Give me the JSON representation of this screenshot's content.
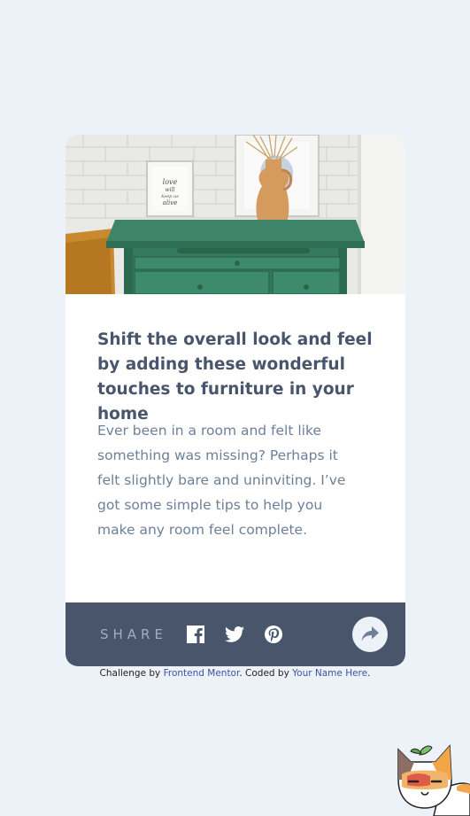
{
  "article": {
    "title": "Shift the overall look and feel by adding these wonderful touches to furniture in your home",
    "description": "Ever been in a room and felt like something was missing? Perhaps it felt slightly bare and uninviting. I’ve got some simple tips to help you make any room feel complete.",
    "hero_frame_text": "love will keep us alive"
  },
  "share_bar": {
    "label": "SHARE",
    "icons": [
      "facebook-icon",
      "twitter-icon",
      "pinterest-icon"
    ],
    "share_button_icon": "share-arrow-icon"
  },
  "attribution": {
    "prefix": "Challenge by ",
    "link1": "Frontend Mentor",
    "middle": ". Coded by ",
    "link2": "Your Name Here",
    "suffix": "."
  },
  "colors": {
    "page_background": "#ecf2f8",
    "card_background": "#ffffff",
    "title": "#48556a",
    "description": "#6e8098",
    "share_bar": "#48556a",
    "share_label": "#9eafc2",
    "link": "#3e52a3"
  }
}
